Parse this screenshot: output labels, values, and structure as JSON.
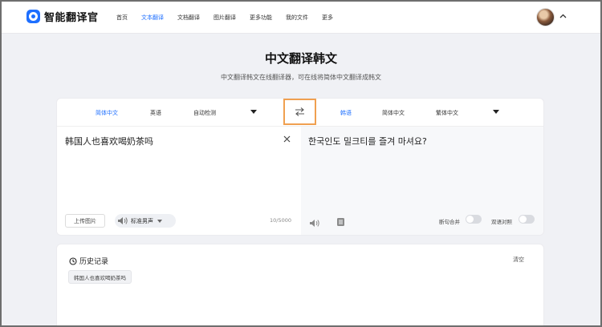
{
  "app": {
    "name": "智能翻译官"
  },
  "nav": {
    "items": [
      {
        "label": "首页"
      },
      {
        "label": "文本翻译"
      },
      {
        "label": "文档翻译"
      },
      {
        "label": "图片翻译"
      },
      {
        "label": "更多功能"
      },
      {
        "label": "我的文件"
      },
      {
        "label": "更多"
      }
    ],
    "active_index": 1
  },
  "header": {
    "title": "中文翻译韩文",
    "subtitle": "中文翻译韩文在线翻译器，可在线将简体中文翻译成韩文"
  },
  "translator": {
    "source_langs": [
      "简体中文",
      "英语",
      "自动检测"
    ],
    "target_langs": [
      "韩语",
      "简体中文",
      "繁体中文"
    ],
    "source_text": "韩国人也喜欢喝奶茶吗",
    "target_text": "한국인도 밀크티를 즐겨 마셔요?",
    "upload_label": "上传图片",
    "voice_label": "标准男声",
    "char_count": "10/5000",
    "toggles": {
      "merge_label": "断句合并",
      "bilingual_label": "双语对照"
    }
  },
  "history": {
    "title": "历史记录",
    "clear_label": "清空",
    "items": [
      "韩国人也喜欢喝奶茶吗"
    ]
  },
  "colors": {
    "accent": "#1e6fff",
    "highlight_border": "#f0a050"
  },
  "icons": [
    "logo-icon",
    "chevron-up-icon",
    "swap-icon",
    "close-icon",
    "speaker-icon",
    "copy-icon",
    "history-clock-icon"
  ]
}
